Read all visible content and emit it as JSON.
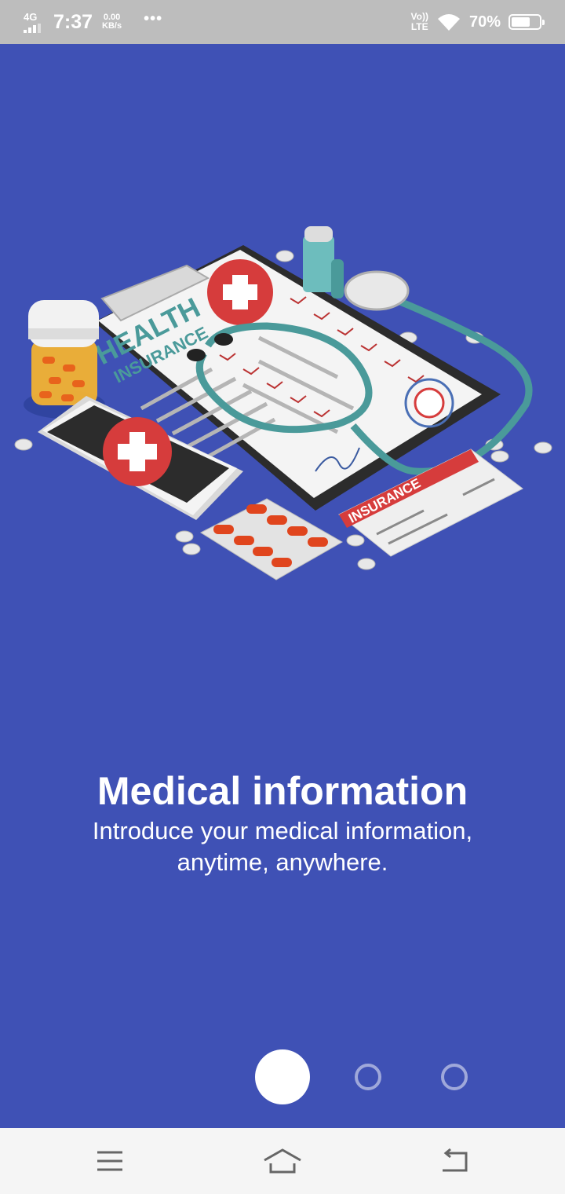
{
  "status_bar": {
    "network": "4G",
    "time": "7:37",
    "speed_value": "0.00",
    "speed_unit": "KB/s",
    "overflow": "•••",
    "volte_top": "Vo))",
    "volte_bottom": "LTE",
    "battery_percent": "70%",
    "battery_level": 0.7,
    "signal_icon": "signal-icon",
    "wifi_icon": "wifi-icon",
    "battery_icon": "battery-icon"
  },
  "illustration": {
    "clipboard_heading": "HEALTH",
    "clipboard_subheading": "INSURANCE",
    "card_label": "INSURANCE"
  },
  "onboarding": {
    "title": "Medical information",
    "subtitle": "Introduce your medical information, anytime, anywhere.",
    "page_count": 3,
    "current_page": 1
  },
  "nav_bar": {
    "menu_icon": "menu-icon",
    "home_icon": "home-icon",
    "back_icon": "back-icon"
  },
  "colors": {
    "background": "#3f51b5",
    "status_bar": "#bdbdbd",
    "accent_red": "#d63c3c",
    "teal": "#4a9a9a",
    "dot_inactive": "#9fa8da"
  }
}
